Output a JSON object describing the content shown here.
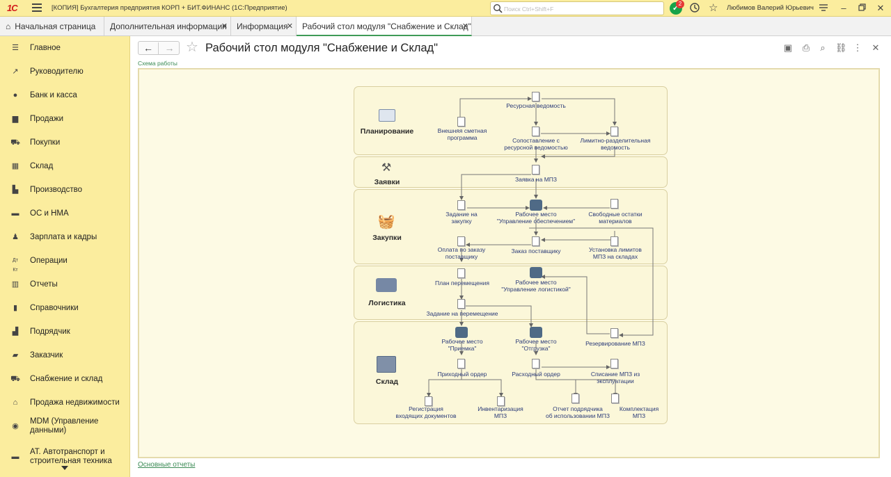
{
  "app": {
    "logo": "1С",
    "title": "[КОПИЯ] Бухгалтерия предприятия КОРП + БИТ.ФИНАНС  (1С:Предприятие)",
    "search_placeholder": "Поиск Ctrl+Shift+F",
    "notifications_count": "2",
    "user": "Любимов Валерий Юрьевич"
  },
  "tabs": [
    {
      "label": "Начальная страница"
    },
    {
      "label": "Дополнительная информация"
    },
    {
      "label": "Информация"
    },
    {
      "label": "Рабочий стол модуля \"Снабжение и Склад\""
    }
  ],
  "sidebar": {
    "items": [
      {
        "label": "Главное",
        "icon": "menu-icon"
      },
      {
        "label": "Руководителю",
        "icon": "chart-line-icon"
      },
      {
        "label": "Банк и касса",
        "icon": "coin-icon"
      },
      {
        "label": "Продажи",
        "icon": "shopping-bag-icon"
      },
      {
        "label": "Покупки",
        "icon": "cart-icon"
      },
      {
        "label": "Склад",
        "icon": "warehouse-icon"
      },
      {
        "label": "Производство",
        "icon": "factory-icon"
      },
      {
        "label": "ОС и НМА",
        "icon": "truck-icon"
      },
      {
        "label": "Зарплата и кадры",
        "icon": "person-icon"
      },
      {
        "label": "Операции",
        "icon": "dt-kt-icon"
      },
      {
        "label": "Отчеты",
        "icon": "bar-chart-icon"
      },
      {
        "label": "Справочники",
        "icon": "books-icon"
      },
      {
        "label": "Подрядчик",
        "icon": "building-icon"
      },
      {
        "label": "Заказчик",
        "icon": "briefcase-icon"
      },
      {
        "label": "Снабжение и склад",
        "icon": "supply-cart-icon"
      },
      {
        "label": "Продажа недвижимости",
        "icon": "house-icon"
      },
      {
        "label": "MDM (Управление данными)",
        "icon": "database-icon"
      },
      {
        "label": "АТ. Автотранспорт и строительная техника",
        "icon": "vehicle-icon"
      }
    ]
  },
  "page": {
    "title": "Рабочий стол модуля \"Снабжение и Склад\"",
    "scheme_link": "Схема работы",
    "reports_link": "Основные отчеты"
  },
  "diagram": {
    "sections": [
      {
        "label": "Планирование",
        "icon": "planning-icon"
      },
      {
        "label": "Заявки",
        "icon": "hammer-icon"
      },
      {
        "label": "Закупки",
        "icon": "basket-icon"
      },
      {
        "label": "Логистика",
        "icon": "logistics-icon"
      },
      {
        "label": "Склад",
        "icon": "warehouse-box-icon"
      }
    ],
    "nodes": {
      "resource_statement": "Ресурсная ведомость",
      "external_estimate": "Внешняя сметная\nпрограмма",
      "comparison": "Сопоставление с\nресурсной ведомостью",
      "limit_statement": "Лимитно-разделительная\nведомость",
      "mpz_request": "Заявка на МПЗ",
      "purchase_task": "Задание на\nзакупку",
      "supply_workplace": "Рабочее место\n\"Управление обеспечением\"",
      "free_balances": "Свободные остатки\nматериалов",
      "order_payment": "Оплата по заказу\nпоставщику",
      "supplier_order": "Заказ поставщику",
      "set_limits": "Установка лимитов\nМПЗ на складах",
      "move_plan": "План перемещения",
      "logistics_workplace": "Рабочее место\n\"Управление логистикой\"",
      "move_task": "Задание на перемещение",
      "receiving_workplace": "Рабочее место\n\"Приемка\"",
      "shipping_workplace": "Рабочее место\n\"Отгрузка\"",
      "reserve": "Резервирование МПЗ",
      "receipt_order": "Приходный ордер",
      "expense_order": "Расходный ордер",
      "writeoff": "Списание МПЗ из\nэксплуатации",
      "register_docs": "Регистрация\nвходящих документов",
      "inventory": "Инвентаризация\nМПЗ",
      "contractor_report": "Отчет подрядчика\nоб использовании МПЗ",
      "assembly": "Комплектация\nМПЗ"
    }
  }
}
